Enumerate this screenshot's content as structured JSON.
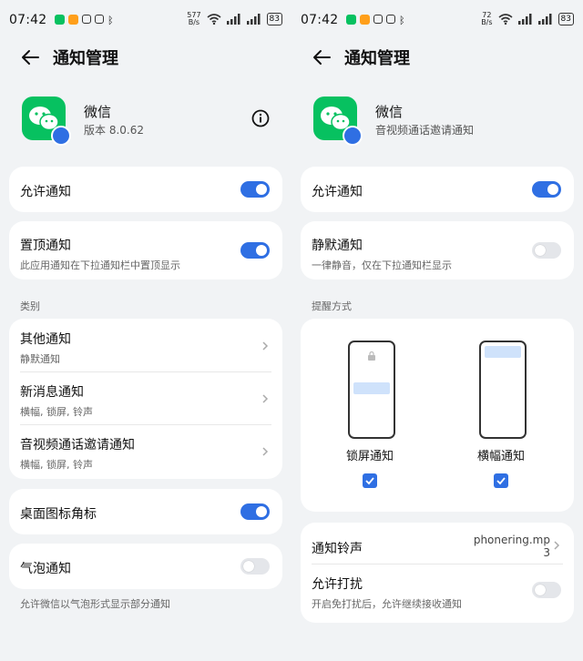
{
  "left": {
    "status": {
      "time": "07:42",
      "speed": "577\nB/s",
      "battery": "83"
    },
    "header": {
      "title": "通知管理"
    },
    "app": {
      "name": "微信",
      "subtitle": "版本 8.0.62"
    },
    "allow": {
      "label": "允许通知",
      "on": true
    },
    "pin": {
      "label": "置顶通知",
      "desc": "此应用通知在下拉通知栏中置顶显示",
      "on": true
    },
    "category_label": "类别",
    "categories": [
      {
        "title": "其他通知",
        "sub": "静默通知"
      },
      {
        "title": "新消息通知",
        "sub": "横幅, 锁屏, 铃声"
      },
      {
        "title": "音视频通话邀请通知",
        "sub": "横幅, 锁屏, 铃声"
      }
    ],
    "badge": {
      "label": "桌面图标角标",
      "on": true
    },
    "bubble": {
      "label": "气泡通知",
      "on": false
    },
    "footnote": "允许微信以气泡形式显示部分通知"
  },
  "right": {
    "status": {
      "time": "07:42",
      "speed": "72\nB/s",
      "battery": "83"
    },
    "header": {
      "title": "通知管理"
    },
    "app": {
      "name": "微信",
      "subtitle": "音视频通话邀请通知"
    },
    "allow": {
      "label": "允许通知",
      "on": true
    },
    "silent": {
      "label": "静默通知",
      "desc": "一律静音，仅在下拉通知栏显示",
      "on": false
    },
    "reminder_label": "提醒方式",
    "styles": [
      {
        "label": "锁屏通知",
        "checked": true
      },
      {
        "label": "横幅通知",
        "checked": true
      }
    ],
    "ringtone": {
      "label": "通知铃声",
      "value_line1": "phonering.mp",
      "value_line2": "3"
    },
    "dnd": {
      "label": "允许打扰",
      "desc": "开启免打扰后，允许继续接收通知",
      "on": false
    }
  },
  "colors": {
    "accent": "#2f6fe3",
    "wechat": "#07c160",
    "background": "#f1f3f5"
  }
}
